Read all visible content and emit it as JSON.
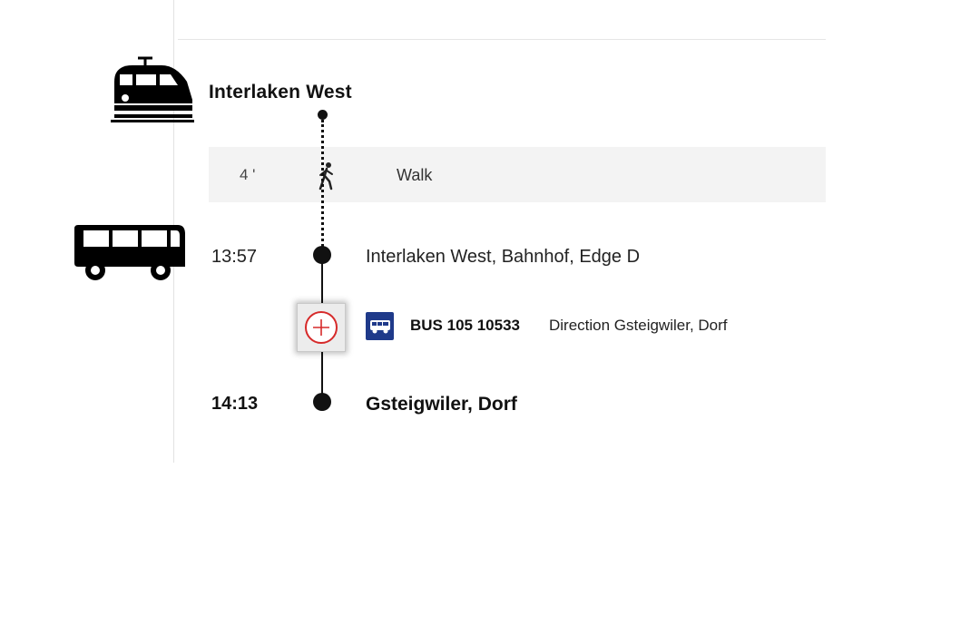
{
  "origin": {
    "name": "Interlaken West",
    "icon": "train-icon"
  },
  "walk": {
    "duration": "4 '",
    "label": "Walk",
    "icon": "walk-icon"
  },
  "bus_leg": {
    "icon": "bus-icon",
    "departure_time": "13:57",
    "departure_stop": "Interlaken West, Bahnhof, Edge D",
    "line": "BUS 105 10533",
    "direction": "Direction Gsteigwiler, Dorf",
    "arrival_time": "14:13",
    "arrival_stop": "Gsteigwiler, Dorf",
    "expand_icon": "plus-circle-icon",
    "badge_icon": "bus-badge-icon"
  },
  "colors": {
    "badge": "#1f3a8a",
    "expand_accent": "#d62a2a",
    "walk_row_bg": "#f3f3f3"
  }
}
